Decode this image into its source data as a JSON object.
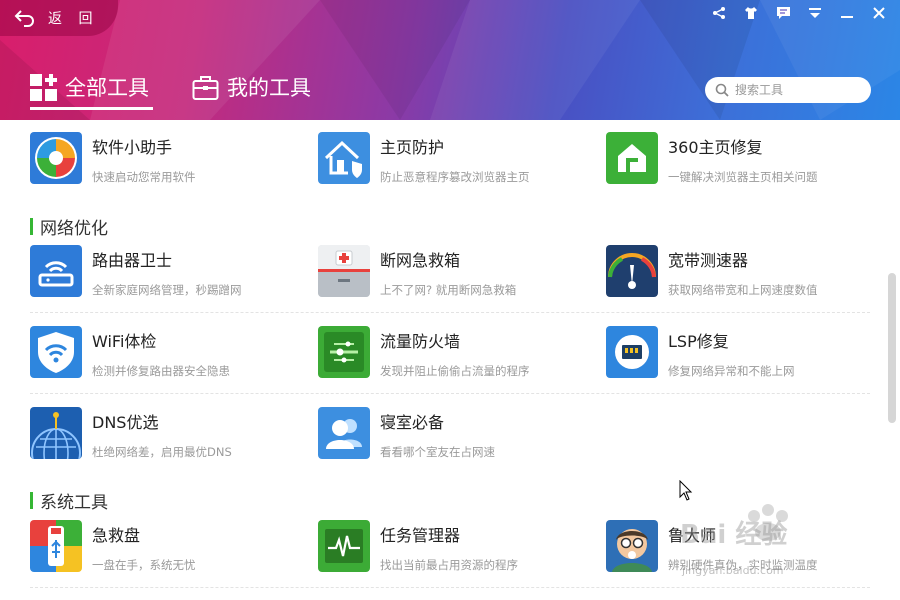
{
  "header": {
    "back_label": "返 回",
    "tabs": [
      {
        "label": "全部工具",
        "active": true
      },
      {
        "label": "我的工具",
        "active": false
      }
    ],
    "search_placeholder": "搜索工具"
  },
  "window_controls": [
    "share-icon",
    "skin-icon",
    "feedback-icon",
    "menu-icon",
    "minimize-icon",
    "close-icon"
  ],
  "tools_top": [
    {
      "name": "软件小助手",
      "desc": "快速启动您常用软件",
      "color": "#2e7bd8"
    },
    {
      "name": "主页防护",
      "desc": "防止恶意程序篡改浏览器主页",
      "color": "#3d8fe0"
    },
    {
      "name": "360主页修复",
      "desc": "一键解决浏览器主页相关问题",
      "color": "#3cb038"
    }
  ],
  "sections": [
    {
      "title": "网络优化",
      "tools": [
        {
          "name": "路由器卫士",
          "desc": "全新家庭网络管理，秒踢蹭网",
          "color": "#2e7bd8"
        },
        {
          "name": "断网急救箱",
          "desc": "上不了网? 就用断网急救箱",
          "color": "#d9dde2"
        },
        {
          "name": "宽带测速器",
          "desc": "获取网络带宽和上网速度数值",
          "color": "#1f3f6e"
        },
        {
          "name": "WiFi体检",
          "desc": "检测并修复路由器安全隐患",
          "color": "#2e86de"
        },
        {
          "name": "流量防火墙",
          "desc": "发现并阻止偷偷占流量的程序",
          "color": "#3cab36"
        },
        {
          "name": "LSP修复",
          "desc": "修复网络异常和不能上网",
          "color": "#2e86de"
        },
        {
          "name": "DNS优选",
          "desc": "杜绝网络差，启用最优DNS",
          "color": "#1d5fb0"
        },
        {
          "name": "寝室必备",
          "desc": "看看哪个室友在占网速",
          "color": "#3d8fe0"
        }
      ]
    },
    {
      "title": "系统工具",
      "tools": [
        {
          "name": "急救盘",
          "desc": "一盘在手，系统无忧",
          "color": "#2e7bd8"
        },
        {
          "name": "任务管理器",
          "desc": "找出当前最占用资源的程序",
          "color": "#3cab36"
        },
        {
          "name": "鲁大师",
          "desc": "辨别硬件真伪，实时监测温度",
          "color": "#2e6fb6"
        }
      ]
    }
  ],
  "watermark": {
    "text": "Bai 经验",
    "sub": "jingyan.baidu.com"
  }
}
